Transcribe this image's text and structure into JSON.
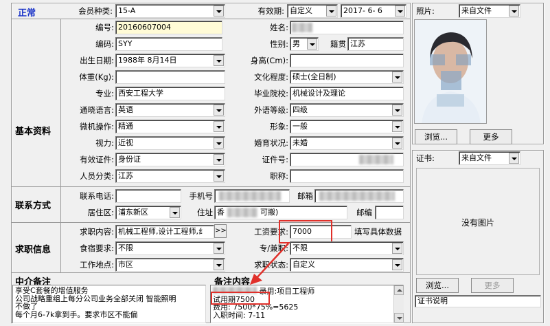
{
  "header": {
    "status": "正常",
    "member_type_label": "会员种类:",
    "member_type_value": "15-A",
    "validity_label": "有效期:",
    "validity_mode": "自定义",
    "validity_date": "2017- 6- 6",
    "photo_label": "照片:",
    "photo_source": "来自文件"
  },
  "basic": {
    "section_title": "基本资料",
    "number_label": "编号:",
    "number_value": "20160607004",
    "code_label": "编码:",
    "code_value": "SYY",
    "birth_label": "出生日期:",
    "birth_value": "1988年 8月14日",
    "weight_label": "体重(Kg):",
    "weight_value": "",
    "major_label": "专业:",
    "major_value": "西安工程大学",
    "language_label": "通晓语言:",
    "language_value": "英语",
    "computer_label": "微机操作:",
    "computer_value": "精通",
    "vision_label": "视力:",
    "vision_value": "近视",
    "id_type_label": "有效证件:",
    "id_type_value": "身份证",
    "category_label": "人员分类:",
    "category_value": "江苏",
    "name_label": "姓名:",
    "gender_label": "性别:",
    "gender_value": "男",
    "native_label": "籍贯",
    "native_value": "江苏",
    "height_label": "身高(Cm):",
    "height_value": "",
    "education_label": "文化程度:",
    "education_value": "硕士(全日制)",
    "school_label": "毕业院校:",
    "school_value": "机械设计及理论",
    "foreign_level_label": "外语等级:",
    "foreign_level_value": "四级",
    "appearance_label": "形象:",
    "appearance_value": "一般",
    "marital_label": "婚育状况:",
    "marital_value": "未婚",
    "cert_no_label": "证件号:",
    "title_label": "职称:",
    "title_value": ""
  },
  "contact": {
    "section_title": "联系方式",
    "phone_label": "联系电话:",
    "phone_value": "",
    "mobile_label": "手机号",
    "email_label": "邮箱",
    "district_label": "居住区:",
    "district_value": "浦东新区",
    "address_label": "住址",
    "address_prefix": "香",
    "address_suffix": "可搬)",
    "postcode_label": "邮编",
    "postcode_value": ""
  },
  "job": {
    "section_title": "求职信息",
    "intent_label": "求职内容:",
    "intent_value": "机械工程师,设计工程师,纟",
    "intent_more": ">>",
    "salary_label": "工资要求:",
    "salary_value": "7000",
    "salary_hint": "填写具体数据",
    "board_label": "食宿要求:",
    "board_value": "不限",
    "fulltime_label": "专/兼职:",
    "fulltime_value": "不限",
    "location_label": "工作地点:",
    "location_value": "市区",
    "status_label": "求职状态:",
    "status_value": "自定义"
  },
  "agency_notes": {
    "title": "中介备注",
    "lines": [
      "享受C套餐的增值服务",
      "公司战略重组上每分公司业务全部关闭 智能照明",
      "不做了",
      "每个月6-7k拿到手。要求市区不能偏"
    ]
  },
  "remarks": {
    "title": "备注内容",
    "lines": [
      "录用:项目工程师",
      "试用期7500",
      "费用: 7500*75%=5625",
      "入职时间: 7-11"
    ]
  },
  "photo_panel": {
    "browse_button": "浏览...",
    "more_button": "更多"
  },
  "cert_panel": {
    "cert_label": "证书:",
    "cert_source": "来自文件",
    "no_image": "没有图片",
    "browse_button": "浏览...",
    "more_button": "更多",
    "cert_desc": "证书说明"
  }
}
